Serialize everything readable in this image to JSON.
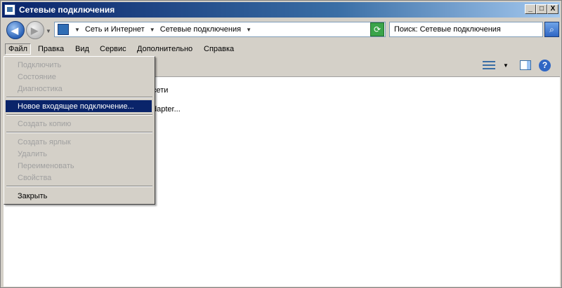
{
  "window": {
    "title": "Сетевые подключения"
  },
  "titlebar_buttons": [
    "_",
    "□",
    "X"
  ],
  "address": {
    "crumbs": [
      "Сеть и Интернет",
      "Сетевые подключения"
    ]
  },
  "search": {
    "placeholder": "Поиск: Сетевые подключения"
  },
  "menubar": [
    "Файл",
    "Правка",
    "Вид",
    "Сервис",
    "Дополнительно",
    "Справка"
  ],
  "content": {
    "item1_partial": "сети",
    "item2_partial": "dapter..."
  },
  "file_menu": {
    "items": [
      {
        "label": "Подключить",
        "enabled": false
      },
      {
        "label": "Состояние",
        "enabled": false
      },
      {
        "label": "Диагностика",
        "enabled": false
      },
      {
        "label": "Новое входящее подключение...",
        "enabled": true,
        "selected": true
      },
      {
        "label": "Создать копию",
        "enabled": false
      },
      {
        "label": "Создать ярлык",
        "enabled": false
      },
      {
        "label": "Удалить",
        "enabled": false
      },
      {
        "label": "Переименовать",
        "enabled": false
      },
      {
        "label": "Свойства",
        "enabled": false
      },
      {
        "label": "Закрыть",
        "enabled": true
      }
    ]
  },
  "colors": {
    "highlight": "#0a246a",
    "window_bg": "#d4d0c8",
    "disabled_text": "#a0a0a0"
  }
}
